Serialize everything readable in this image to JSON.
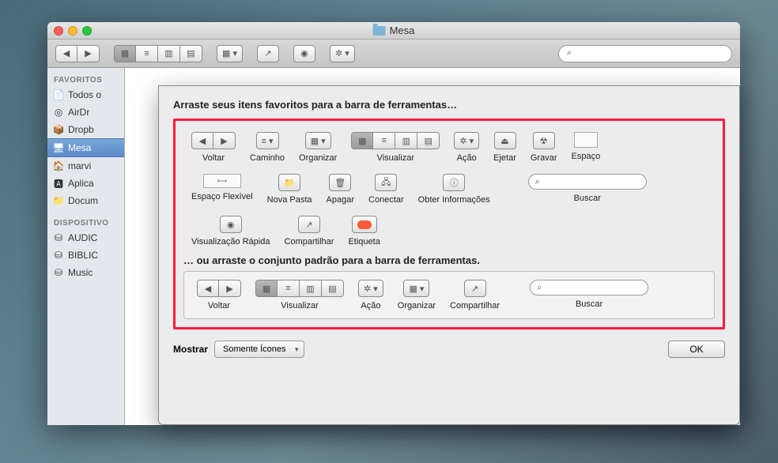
{
  "window": {
    "title": "Mesa"
  },
  "sidebar": {
    "favorites_header": "FAVORITOS",
    "devices_header": "DISPOSITIVO",
    "favorites": [
      {
        "label": "Todos o"
      },
      {
        "label": "AirDr"
      },
      {
        "label": "Dropb"
      },
      {
        "label": "Mesa"
      },
      {
        "label": "marvi"
      },
      {
        "label": "Aplica"
      },
      {
        "label": "Docum"
      }
    ],
    "devices": [
      {
        "label": "AUDIC"
      },
      {
        "label": "BIBLIC"
      },
      {
        "label": "Music"
      }
    ]
  },
  "sheet": {
    "heading": "Arraste seus itens favoritos para a barra de ferramentas…",
    "subheading": "… ou arraste o conjunto padrão para a barra de ferramentas.",
    "palette": {
      "voltar": "Voltar",
      "caminho": "Caminho",
      "organizar": "Organizar",
      "visualizar": "Visualizar",
      "acao": "Ação",
      "ejetar": "Ejetar",
      "gravar": "Gravar",
      "espaco": "Espaço",
      "espaco_flexivel": "Espaço Flexível",
      "nova_pasta": "Nova Pasta",
      "apagar": "Apagar",
      "conectar": "Conectar",
      "obter_info": "Obter Informações",
      "buscar": "Buscar",
      "visualizacao_rapida": "Visualização Rápida",
      "compartilhar": "Compartilhar",
      "etiqueta": "Etiqueta"
    },
    "defaults": {
      "voltar": "Voltar",
      "visualizar": "Visualizar",
      "acao": "Ação",
      "organizar": "Organizar",
      "compartilhar": "Compartilhar",
      "buscar": "Buscar"
    }
  },
  "footer": {
    "show_label": "Mostrar",
    "select_value": "Somente Ícones",
    "ok": "OK"
  },
  "search": {
    "placeholder": ""
  }
}
